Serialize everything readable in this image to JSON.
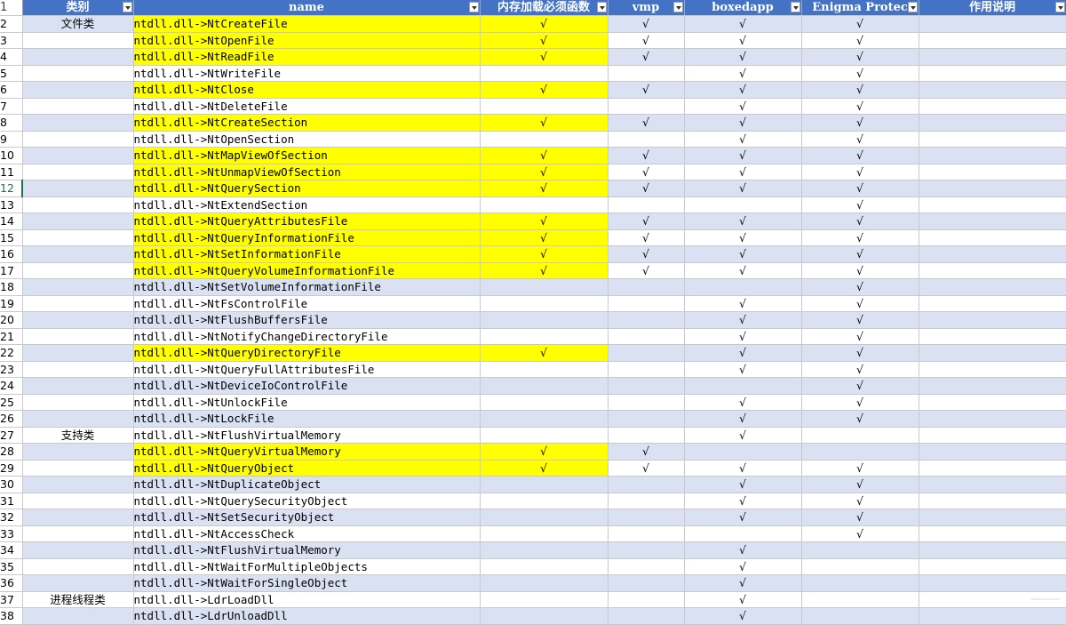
{
  "header": {
    "row_number": "1",
    "columns": [
      "类别",
      "name",
      "内存加载必须函数",
      "vmp",
      "boxedapp",
      "Enigma Protec",
      "作用说明"
    ]
  },
  "check_mark": "√",
  "colors": {
    "header": "#4472c4",
    "band": "#d9e1f2",
    "highlight": "#ffff00"
  },
  "rows": [
    {
      "n": "2",
      "cat": "文件类",
      "name": "ntdll.dll->NtCreateFile",
      "hl": true,
      "must": true,
      "vmp": true,
      "box": true,
      "enigma": true
    },
    {
      "n": "3",
      "cat": "",
      "name": "ntdll.dll->NtOpenFile",
      "hl": true,
      "must": true,
      "vmp": true,
      "box": true,
      "enigma": true
    },
    {
      "n": "4",
      "cat": "",
      "name": "ntdll.dll->NtReadFile",
      "hl": true,
      "must": true,
      "vmp": true,
      "box": true,
      "enigma": true
    },
    {
      "n": "5",
      "cat": "",
      "name": "ntdll.dll->NtWriteFile",
      "hl": false,
      "must": false,
      "vmp": false,
      "box": true,
      "enigma": true
    },
    {
      "n": "6",
      "cat": "",
      "name": "ntdll.dll->NtClose",
      "hl": true,
      "must": true,
      "vmp": true,
      "box": true,
      "enigma": true
    },
    {
      "n": "7",
      "cat": "",
      "name": "ntdll.dll->NtDeleteFile",
      "hl": false,
      "must": false,
      "vmp": false,
      "box": true,
      "enigma": true
    },
    {
      "n": "8",
      "cat": "",
      "name": "ntdll.dll->NtCreateSection",
      "hl": true,
      "must": true,
      "vmp": true,
      "box": true,
      "enigma": true
    },
    {
      "n": "9",
      "cat": "",
      "name": "ntdll.dll->NtOpenSection",
      "hl": false,
      "must": false,
      "vmp": false,
      "box": true,
      "enigma": true
    },
    {
      "n": "10",
      "cat": "",
      "name": "ntdll.dll->NtMapViewOfSection",
      "hl": true,
      "must": true,
      "vmp": true,
      "box": true,
      "enigma": true
    },
    {
      "n": "11",
      "cat": "",
      "name": "ntdll.dll->NtUnmapViewOfSection",
      "hl": true,
      "must": true,
      "vmp": true,
      "box": true,
      "enigma": true
    },
    {
      "n": "12",
      "cat": "",
      "name": "ntdll.dll->NtQuerySection",
      "hl": true,
      "must": true,
      "vmp": true,
      "box": true,
      "enigma": true
    },
    {
      "n": "13",
      "cat": "",
      "name": "ntdll.dll->NtExtendSection",
      "hl": false,
      "must": false,
      "vmp": false,
      "box": false,
      "enigma": true
    },
    {
      "n": "14",
      "cat": "",
      "name": "ntdll.dll->NtQueryAttributesFile",
      "hl": true,
      "must": true,
      "vmp": true,
      "box": true,
      "enigma": true
    },
    {
      "n": "15",
      "cat": "",
      "name": "ntdll.dll->NtQueryInformationFile",
      "hl": true,
      "must": true,
      "vmp": true,
      "box": true,
      "enigma": true
    },
    {
      "n": "16",
      "cat": "",
      "name": "ntdll.dll->NtSetInformationFile",
      "hl": true,
      "must": true,
      "vmp": true,
      "box": true,
      "enigma": true
    },
    {
      "n": "17",
      "cat": "",
      "name": "ntdll.dll->NtQueryVolumeInformationFile",
      "hl": true,
      "must": true,
      "vmp": true,
      "box": true,
      "enigma": true
    },
    {
      "n": "18",
      "cat": "",
      "name": "ntdll.dll->NtSetVolumeInformationFile",
      "hl": false,
      "must": false,
      "vmp": false,
      "box": false,
      "enigma": true
    },
    {
      "n": "19",
      "cat": "",
      "name": "ntdll.dll->NtFsControlFile",
      "hl": false,
      "must": false,
      "vmp": false,
      "box": true,
      "enigma": true
    },
    {
      "n": "20",
      "cat": "",
      "name": "ntdll.dll->NtFlushBuffersFile",
      "hl": false,
      "must": false,
      "vmp": false,
      "box": true,
      "enigma": true
    },
    {
      "n": "21",
      "cat": "",
      "name": "ntdll.dll->NtNotifyChangeDirectoryFile",
      "hl": false,
      "must": false,
      "vmp": false,
      "box": true,
      "enigma": true
    },
    {
      "n": "22",
      "cat": "",
      "name": "ntdll.dll->NtQueryDirectoryFile",
      "hl": true,
      "must": true,
      "vmp": false,
      "box": true,
      "enigma": true
    },
    {
      "n": "23",
      "cat": "",
      "name": "ntdll.dll->NtQueryFullAttributesFile",
      "hl": false,
      "must": false,
      "vmp": false,
      "box": true,
      "enigma": true
    },
    {
      "n": "24",
      "cat": "",
      "name": "ntdll.dll->NtDeviceIoControlFile",
      "hl": false,
      "must": false,
      "vmp": false,
      "box": false,
      "enigma": true
    },
    {
      "n": "25",
      "cat": "",
      "name": "ntdll.dll->NtUnlockFile",
      "hl": false,
      "must": false,
      "vmp": false,
      "box": true,
      "enigma": true
    },
    {
      "n": "26",
      "cat": "",
      "name": "ntdll.dll->NtLockFile",
      "hl": false,
      "must": false,
      "vmp": false,
      "box": true,
      "enigma": true
    },
    {
      "n": "27",
      "cat": "支持类",
      "name": "ntdll.dll->NtFlushVirtualMemory",
      "hl": false,
      "must": false,
      "vmp": false,
      "box": true,
      "enigma": false
    },
    {
      "n": "28",
      "cat": "",
      "name": "ntdll.dll->NtQueryVirtualMemory",
      "hl": true,
      "must": true,
      "vmp": true,
      "box": false,
      "enigma": false
    },
    {
      "n": "29",
      "cat": "",
      "name": "ntdll.dll->NtQueryObject",
      "hl": true,
      "must": true,
      "vmp": true,
      "box": true,
      "enigma": true
    },
    {
      "n": "30",
      "cat": "",
      "name": "ntdll.dll->NtDuplicateObject",
      "hl": false,
      "must": false,
      "vmp": false,
      "box": true,
      "enigma": true
    },
    {
      "n": "31",
      "cat": "",
      "name": "ntdll.dll->NtQuerySecurityObject",
      "hl": false,
      "must": false,
      "vmp": false,
      "box": true,
      "enigma": true
    },
    {
      "n": "32",
      "cat": "",
      "name": "ntdll.dll->NtSetSecurityObject",
      "hl": false,
      "must": false,
      "vmp": false,
      "box": true,
      "enigma": true
    },
    {
      "n": "33",
      "cat": "",
      "name": "ntdll.dll->NtAccessCheck",
      "hl": false,
      "must": false,
      "vmp": false,
      "box": false,
      "enigma": true
    },
    {
      "n": "34",
      "cat": "",
      "name": "ntdll.dll->NtFlushVirtualMemory",
      "hl": false,
      "must": false,
      "vmp": false,
      "box": true,
      "enigma": false
    },
    {
      "n": "35",
      "cat": "",
      "name": "ntdll.dll->NtWaitForMultipleObjects",
      "hl": false,
      "must": false,
      "vmp": false,
      "box": true,
      "enigma": false
    },
    {
      "n": "36",
      "cat": "",
      "name": "ntdll.dll->NtWaitForSingleObject",
      "hl": false,
      "must": false,
      "vmp": false,
      "box": true,
      "enigma": false
    },
    {
      "n": "37",
      "cat": "进程线程类",
      "name": "ntdll.dll->LdrLoadDll",
      "hl": false,
      "must": false,
      "vmp": false,
      "box": true,
      "enigma": false
    },
    {
      "n": "38",
      "cat": "",
      "name": "ntdll.dll->LdrUnloadDll",
      "hl": false,
      "must": false,
      "vmp": false,
      "box": true,
      "enigma": false
    }
  ],
  "active_row": "12"
}
